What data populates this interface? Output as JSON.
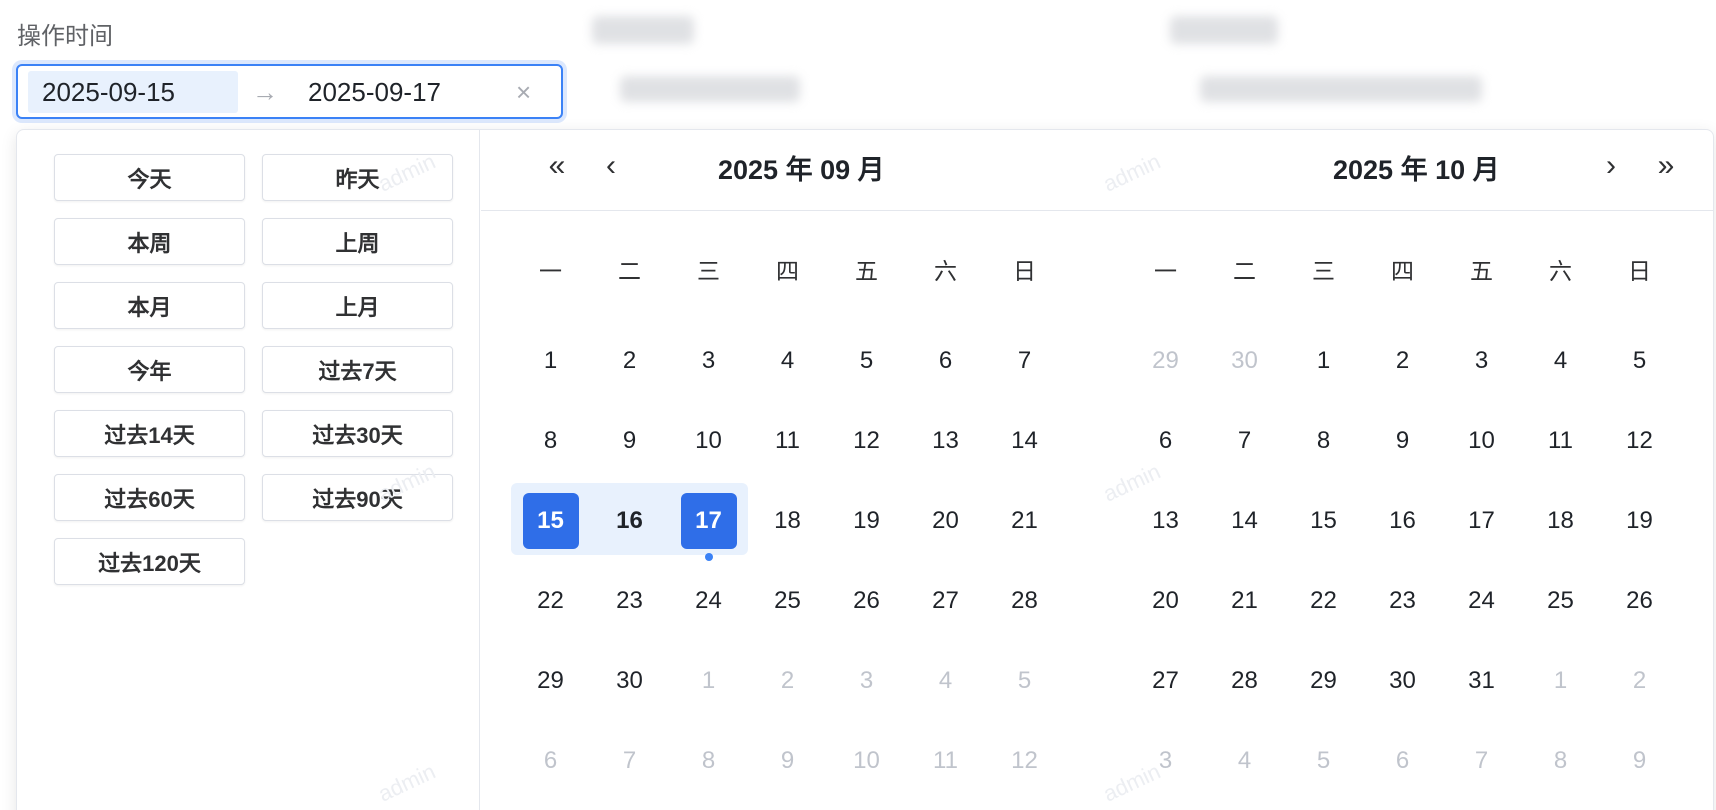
{
  "field": {
    "label": "操作时间",
    "start": "2025-09-15",
    "separator": "→",
    "end": "2025-09-17",
    "clear": "×"
  },
  "shortcuts": [
    "今天",
    "昨天",
    "本周",
    "上周",
    "本月",
    "上月",
    "今年",
    "过去7天",
    "过去14天",
    "过去30天",
    "过去60天",
    "过去90天",
    "过去120天"
  ],
  "nav": {
    "prev_year": "«",
    "prev_month": "‹",
    "next_month": "›",
    "next_year": "»"
  },
  "weekdays": [
    "一",
    "二",
    "三",
    "四",
    "五",
    "六",
    "日"
  ],
  "calendars": [
    {
      "title": "2025 年 09 月",
      "weeks": [
        [
          [
            "1",
            ""
          ],
          [
            "2",
            ""
          ],
          [
            "3",
            ""
          ],
          [
            "4",
            ""
          ],
          [
            "5",
            ""
          ],
          [
            "6",
            ""
          ],
          [
            "7",
            ""
          ]
        ],
        [
          [
            "8",
            ""
          ],
          [
            "9",
            ""
          ],
          [
            "10",
            ""
          ],
          [
            "11",
            ""
          ],
          [
            "12",
            ""
          ],
          [
            "13",
            ""
          ],
          [
            "14",
            ""
          ]
        ],
        [
          [
            "15",
            "selected"
          ],
          [
            "16",
            "mid"
          ],
          [
            "17",
            "selected today"
          ],
          [
            "18",
            ""
          ],
          [
            "19",
            ""
          ],
          [
            "20",
            ""
          ],
          [
            "21",
            ""
          ]
        ],
        [
          [
            "22",
            ""
          ],
          [
            "23",
            ""
          ],
          [
            "24",
            ""
          ],
          [
            "25",
            ""
          ],
          [
            "26",
            ""
          ],
          [
            "27",
            ""
          ],
          [
            "28",
            ""
          ]
        ],
        [
          [
            "29",
            ""
          ],
          [
            "30",
            ""
          ],
          [
            "1",
            "other"
          ],
          [
            "2",
            "other"
          ],
          [
            "3",
            "other"
          ],
          [
            "4",
            "other"
          ],
          [
            "5",
            "other"
          ]
        ],
        [
          [
            "6",
            "other"
          ],
          [
            "7",
            "other"
          ],
          [
            "8",
            "other"
          ],
          [
            "9",
            "other"
          ],
          [
            "10",
            "other"
          ],
          [
            "11",
            "other"
          ],
          [
            "12",
            "other"
          ]
        ]
      ]
    },
    {
      "title": "2025 年 10 月",
      "weeks": [
        [
          [
            "29",
            "other"
          ],
          [
            "30",
            "other"
          ],
          [
            "1",
            ""
          ],
          [
            "2",
            ""
          ],
          [
            "3",
            ""
          ],
          [
            "4",
            ""
          ],
          [
            "5",
            ""
          ]
        ],
        [
          [
            "6",
            ""
          ],
          [
            "7",
            ""
          ],
          [
            "8",
            ""
          ],
          [
            "9",
            ""
          ],
          [
            "10",
            ""
          ],
          [
            "11",
            ""
          ],
          [
            "12",
            ""
          ]
        ],
        [
          [
            "13",
            ""
          ],
          [
            "14",
            ""
          ],
          [
            "15",
            ""
          ],
          [
            "16",
            ""
          ],
          [
            "17",
            ""
          ],
          [
            "18",
            ""
          ],
          [
            "19",
            ""
          ]
        ],
        [
          [
            "20",
            ""
          ],
          [
            "21",
            ""
          ],
          [
            "22",
            ""
          ],
          [
            "23",
            ""
          ],
          [
            "24",
            ""
          ],
          [
            "25",
            ""
          ],
          [
            "26",
            ""
          ]
        ],
        [
          [
            "27",
            ""
          ],
          [
            "28",
            ""
          ],
          [
            "29",
            ""
          ],
          [
            "30",
            ""
          ],
          [
            "31",
            ""
          ],
          [
            "1",
            "other"
          ],
          [
            "2",
            "other"
          ]
        ],
        [
          [
            "3",
            "other"
          ],
          [
            "4",
            "other"
          ],
          [
            "5",
            "other"
          ],
          [
            "6",
            "other"
          ],
          [
            "7",
            "other"
          ],
          [
            "8",
            "other"
          ],
          [
            "9",
            "other"
          ]
        ]
      ]
    }
  ],
  "watermark": "admin",
  "colors": {
    "accent": "#2f6ee8",
    "range_bg": "#e8f1fd",
    "muted": "#c0c4cc"
  }
}
